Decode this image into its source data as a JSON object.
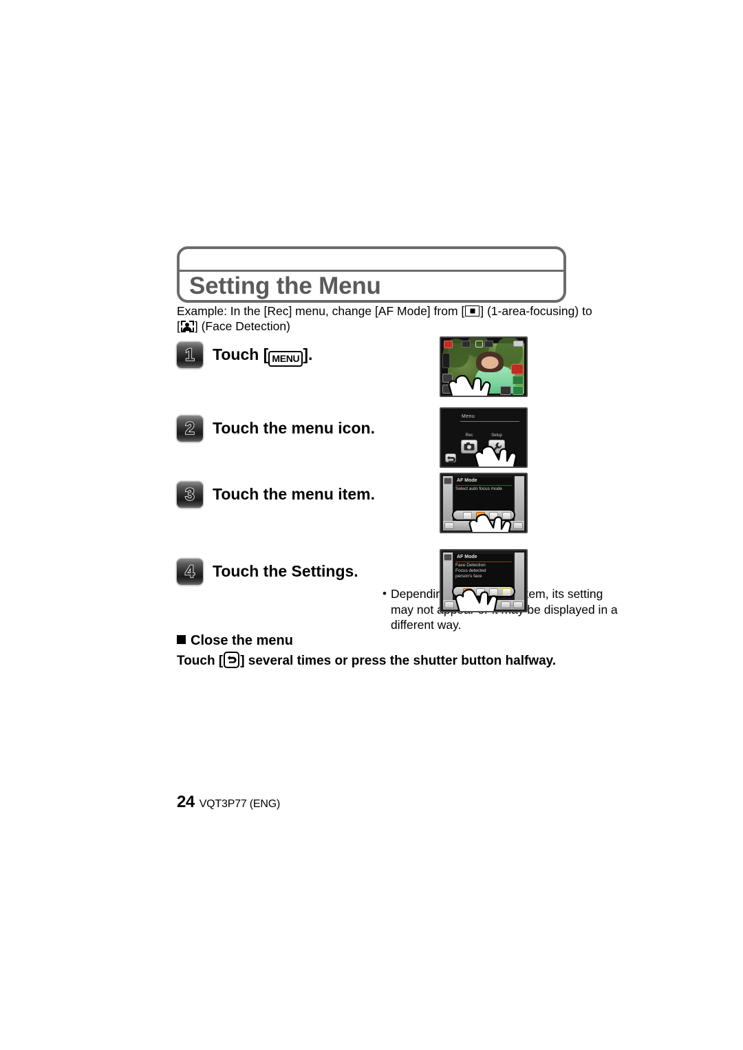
{
  "document": {
    "title": "Setting the Menu",
    "example_line1": "Example: In the [Rec] menu, change [AF Mode] from [",
    "example_line1b": "] (1-area-focusing) to",
    "example_line2a": "] (Face Detection)",
    "glyph_1area": "1-area-focusing-icon",
    "glyph_face": "face-detection-icon"
  },
  "steps": [
    {
      "number": "1",
      "title_before": "Touch [",
      "menu_glyph": "MENU",
      "title_after": "].",
      "screen": {
        "name": "live-view-screen",
        "icons": [
          "rec-mode-icon",
          "image-size-icon",
          "flash-icon",
          "battery-icon",
          "menu-icon",
          "display-icon",
          "camera-icon",
          "playback-icon",
          "scene-icon",
          "zoom-icon"
        ]
      }
    },
    {
      "number": "2",
      "title": "Touch the menu icon.",
      "screen": {
        "name": "menu-screen",
        "heading": "Menu",
        "buttons": [
          {
            "label": "Rec",
            "icon": "camera-icon"
          },
          {
            "label": "Setup",
            "icon": "wrench-icon"
          }
        ],
        "back_icon": "back-arrow-icon"
      }
    },
    {
      "number": "3",
      "title": "Touch the menu item.",
      "screen": {
        "name": "af-mode-select-screen",
        "heading": "AF Mode",
        "body": "Select auto focus mode",
        "options": [
          "af-tracking-icon",
          "1-area-focusing-icon",
          "spot-focusing-icon",
          "multi-area-icon"
        ],
        "selected_index": 1,
        "back_icon": "back-arrow-icon"
      }
    },
    {
      "number": "4",
      "title": "Touch the Settings.",
      "note": "Depending on the menu item, its setting may not appear or it may be displayed in a different way.",
      "note_bullet": "•",
      "screen": {
        "name": "af-mode-face-detection-screen",
        "heading": "AF Mode",
        "body_line1": "Face Detection",
        "body_line2": "Focus detected",
        "body_line3": "person's face",
        "options": [
          "face-detection-icon",
          "af-tracking-icon",
          "multi-area-focusing-icon",
          "1-area-focusing-icon"
        ],
        "selected_index": 0,
        "back_icon": "back-arrow-icon"
      }
    }
  ],
  "close_section": {
    "heading": "Close the menu",
    "line_before": "Touch [",
    "back_glyph": "back-arrow-icon",
    "line_after": "] several times or press the shutter button halfway."
  },
  "footer": {
    "page_number": "24",
    "code": "VQT3P77 (ENG)"
  }
}
